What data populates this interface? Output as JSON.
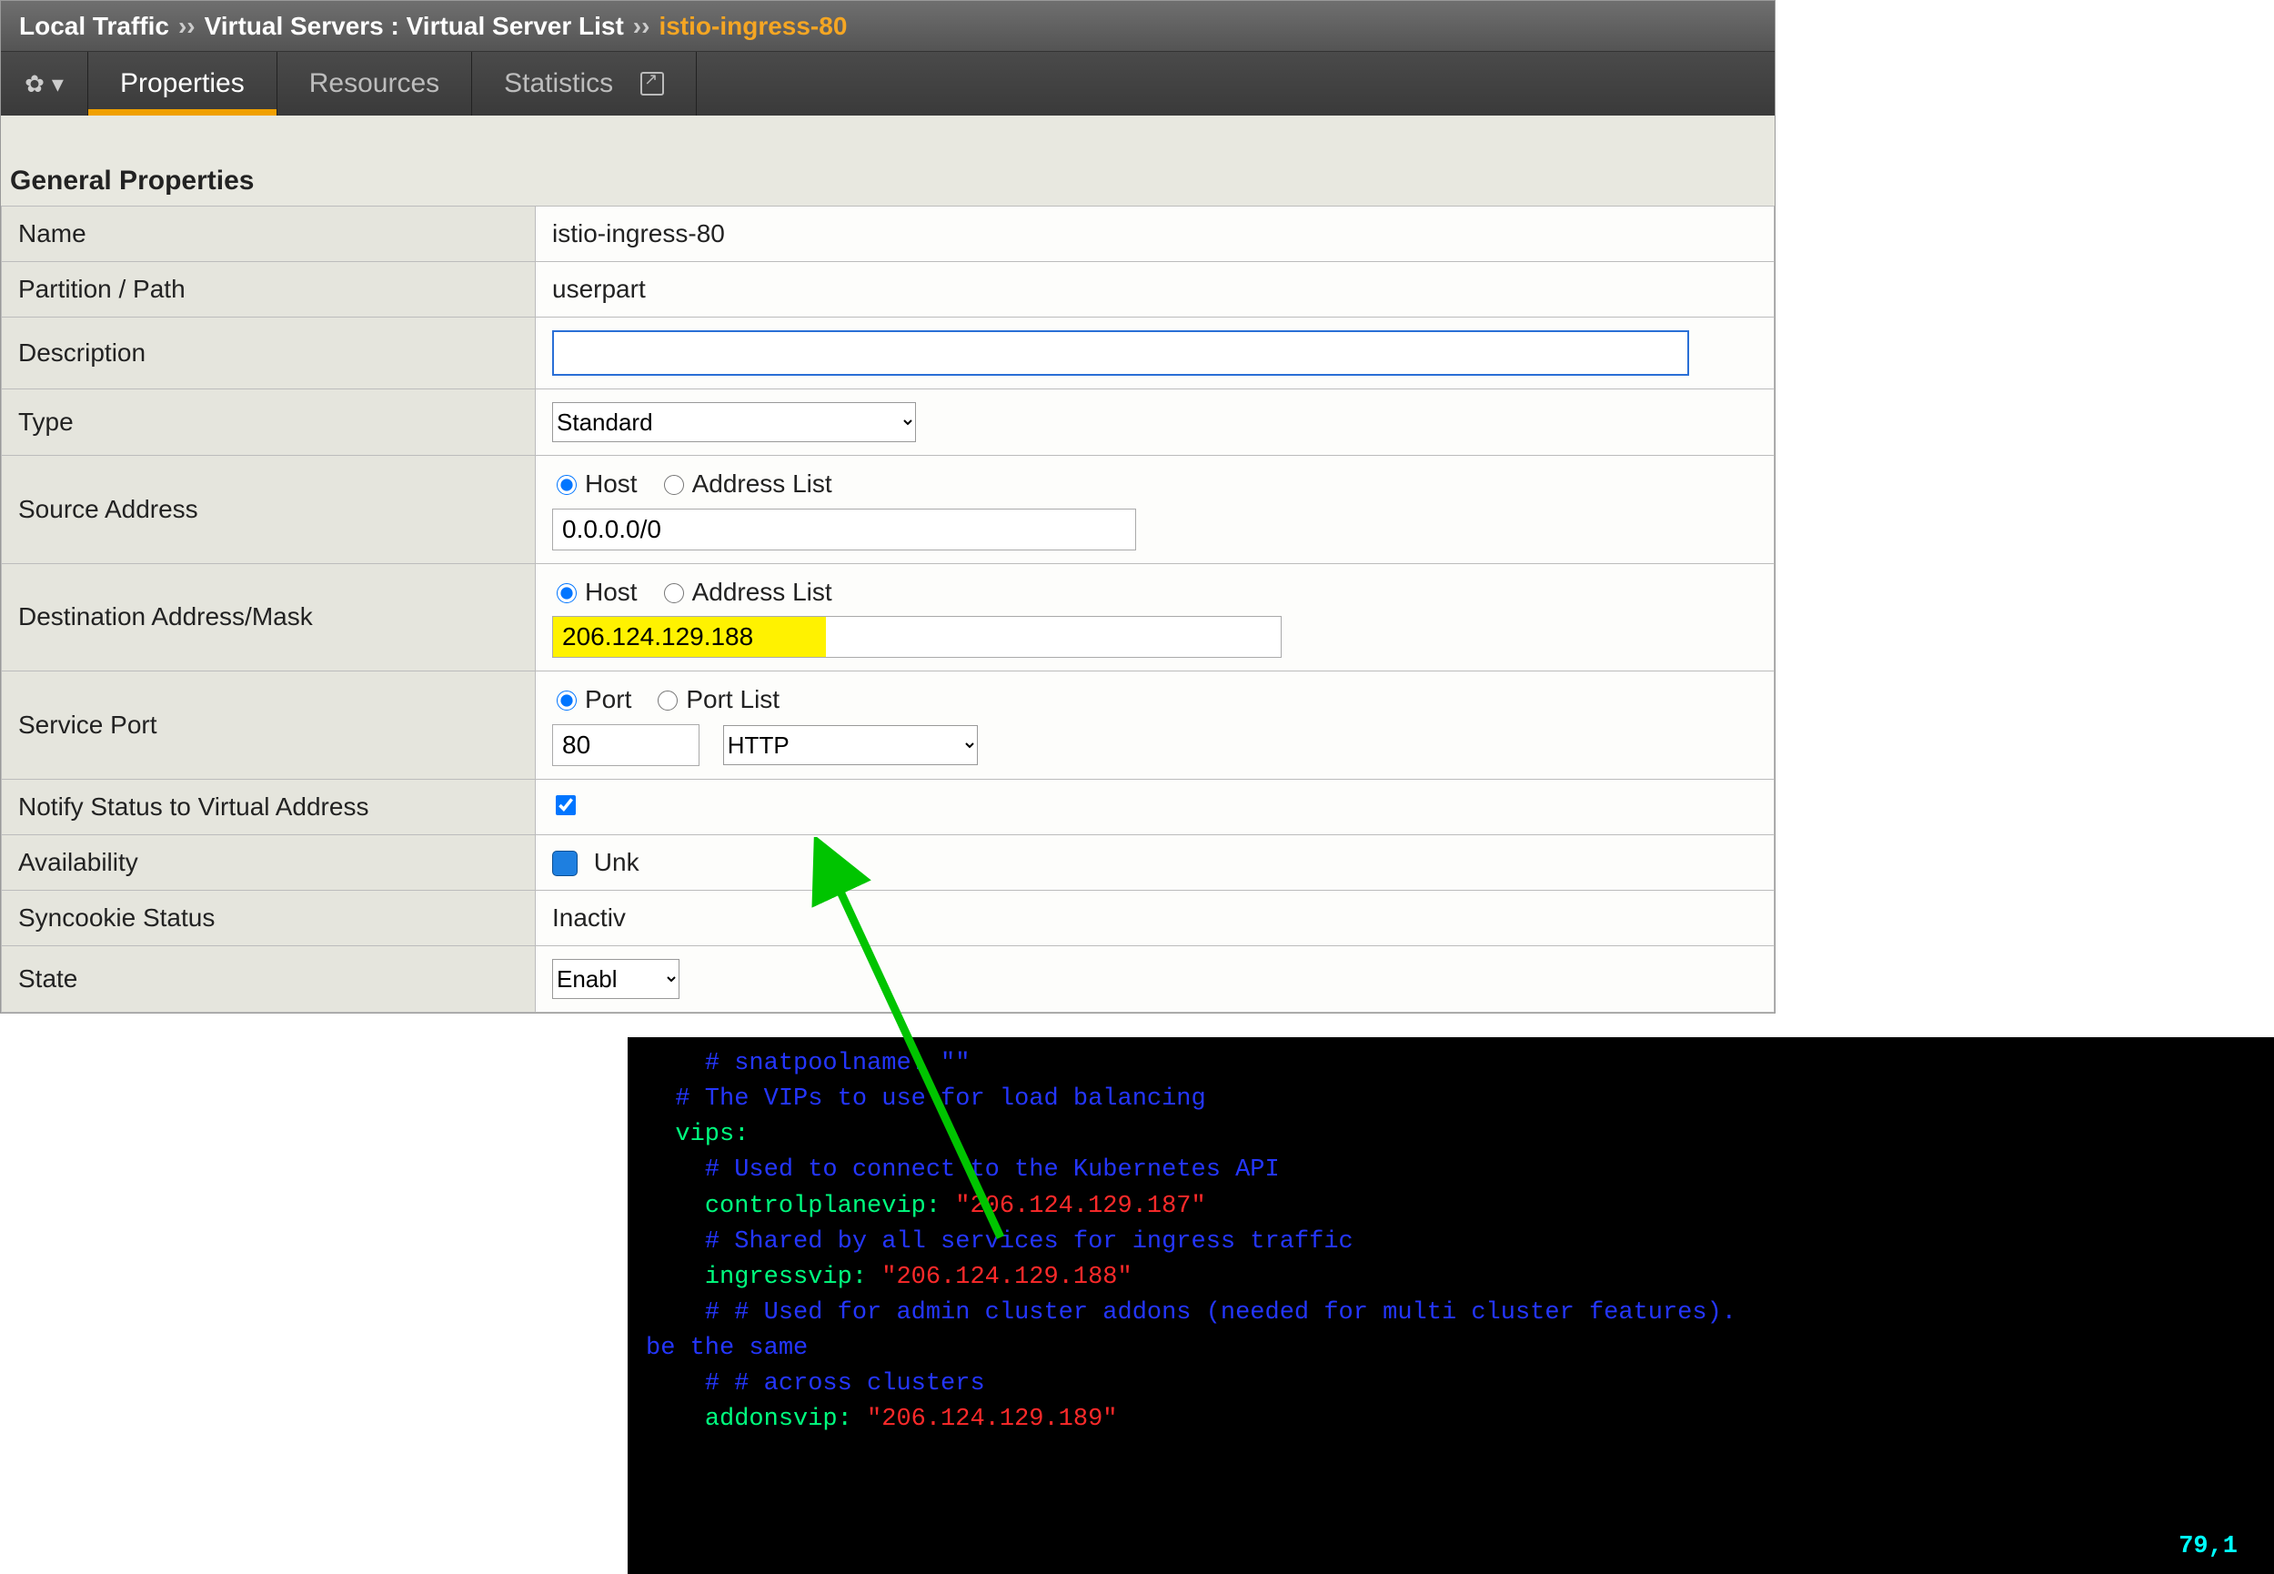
{
  "breadcrumb": {
    "root": "Local Traffic",
    "sep": "››",
    "mid": "Virtual Servers : Virtual Server List",
    "leaf": "istio-ingress-80"
  },
  "tabs": {
    "properties": "Properties",
    "resources": "Resources",
    "statistics": "Statistics"
  },
  "section": {
    "title": "General Properties"
  },
  "rows": {
    "name_label": "Name",
    "name_value": "istio-ingress-80",
    "partition_label": "Partition / Path",
    "partition_value": "userpart",
    "description_label": "Description",
    "description_value": "",
    "type_label": "Type",
    "type_value": "Standard",
    "src_label": "Source Address",
    "radio_host": "Host",
    "radio_addrlist": "Address List",
    "src_value": "0.0.0.0/0",
    "dst_label": "Destination Address/Mask",
    "dst_value": "206.124.129.188",
    "svc_label": "Service Port",
    "radio_port": "Port",
    "radio_portlist": "Port List",
    "svc_port": "80",
    "svc_proto": "HTTP",
    "notify_label": "Notify Status to Virtual Address",
    "avail_label": "Availability",
    "avail_value": "Unk",
    "sync_label": "Syncookie Status",
    "sync_value": "Inactiv",
    "state_label": "State",
    "state_value": "Enabl"
  },
  "terminal": {
    "l1": "# snatpoolname: \"\"",
    "l2": "# The VIPs to use for load balancing",
    "l3_key": "vips",
    "l4": "# Used to connect to the Kubernetes API",
    "l5_key": "controlplanevip",
    "l5_val": "\"206.124.129.187\"",
    "l6": "# Shared by all services for ingress traffic",
    "l7_key": "ingressvip",
    "l7_val": "\"206.124.129.188\"",
    "l8a": "# # Used for admin cluster addons (needed for multi cluster features).",
    "l8b": "be the same",
    "l9": "# # across clusters",
    "l10_key": "addonsvip",
    "l10_val": "\"206.124.129.189\"",
    "pos": "79,1"
  }
}
